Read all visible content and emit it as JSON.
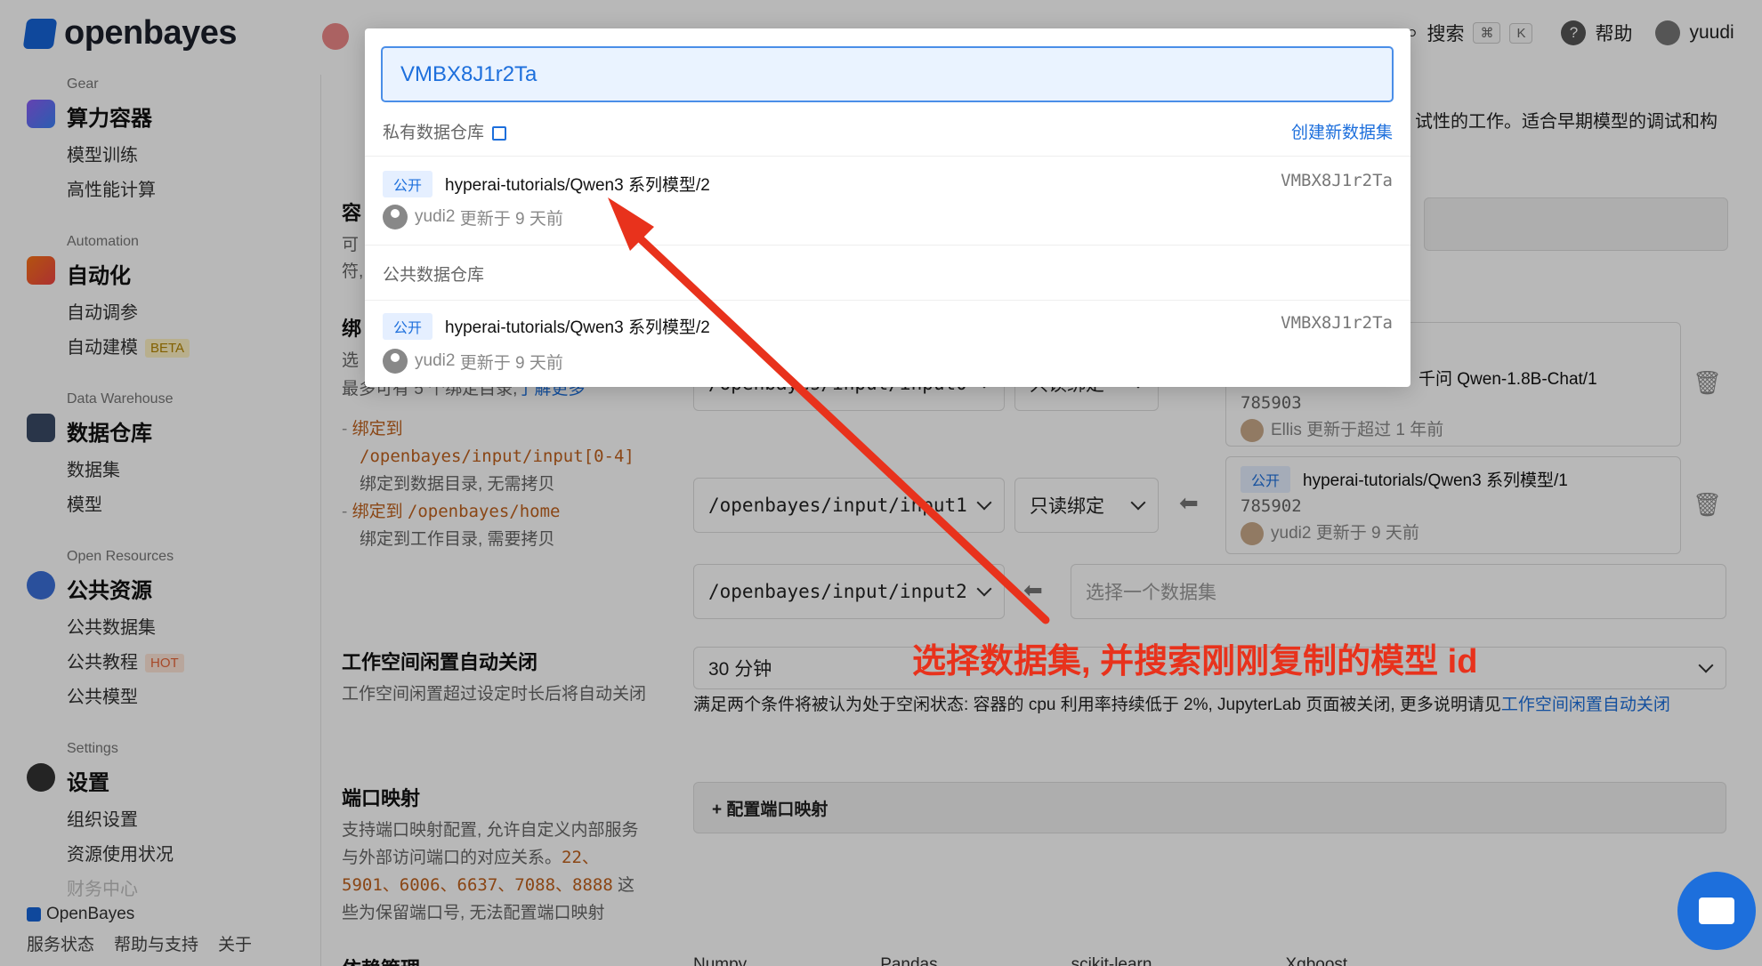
{
  "brand": {
    "name": "openbayes",
    "footer_name": "OpenBayes"
  },
  "sidebar": {
    "sections": [
      {
        "en": "Gear",
        "title": "算力容器",
        "items": [
          "模型训练",
          "高性能计算"
        ]
      },
      {
        "en": "Automation",
        "title": "自动化",
        "items": [
          "自动调参",
          "自动建模"
        ],
        "badge": "BETA"
      },
      {
        "en": "Data Warehouse",
        "title": "数据仓库",
        "items": [
          "数据集",
          "模型"
        ]
      },
      {
        "en": "Open Resources",
        "title": "公共资源",
        "items": [
          "公共数据集",
          "公共教程",
          "公共模型"
        ],
        "badge": "HOT"
      },
      {
        "en": "Settings",
        "title": "设置",
        "items": [
          "组织设置",
          "资源使用状况",
          "财务中心"
        ]
      }
    ],
    "footer_links": [
      "服务状态",
      "帮助与支持",
      "关于"
    ]
  },
  "header": {
    "search_label": "搜索",
    "kbd1": "⌘",
    "kbd2": "K",
    "help_label": "帮助",
    "user": "yuudi"
  },
  "modal": {
    "search_value": "VMBX8J1r2Ta",
    "private_label": "私有数据仓库",
    "create_label": "创建新数据集",
    "public_label": "公共数据仓库",
    "results": [
      {
        "tag": "公开",
        "name": "hyperai-tutorials/Qwen3 系列模型/2",
        "id": "VMBX8J1r2Ta",
        "user": "yudi2",
        "updated": "更新于 9 天前"
      },
      {
        "tag": "公开",
        "name": "hyperai-tutorials/Qwen3 系列模型/2",
        "id": "VMBX8J1r2Ta",
        "user": "yudi2",
        "updated": "更新于 9 天前"
      }
    ]
  },
  "main": {
    "intro_tail": "试性的工作。适合早期模型的调试和构",
    "container_title": "容",
    "container_desc1": "可",
    "container_desc2": "符,",
    "bind_title": "绑",
    "bind_desc1": "选",
    "bind_desc2": "最多可有 5 个绑定目录,",
    "bind_learn_more": "了解更多",
    "bind_rule1_prefix": "绑定到",
    "bind_rule1_path": "/openbayes/input/input[0-4]",
    "bind_rule1_desc": "绑定到数据目录, 无需拷贝",
    "bind_rule2_prefix": "绑定到",
    "bind_rule2_path": "/openbayes/home",
    "bind_rule2_desc": "绑定到工作目录, 需要拷贝",
    "bindings": [
      {
        "path": "/openbayes/input/input0",
        "mode": "只读绑定",
        "ds_name": "千问 Qwen-1.8B-Chat/1",
        "ds_id": "785903",
        "ds_user": "Ellis",
        "ds_updated": "更新于超过 1 年前"
      },
      {
        "path": "/openbayes/input/input1",
        "mode": "只读绑定",
        "ds_tag": "公开",
        "ds_name": "hyperai-tutorials/Qwen3 系列模型/1",
        "ds_id": "785902",
        "ds_user": "yudi2",
        "ds_updated": "更新于 9 天前"
      },
      {
        "path": "/openbayes/input/input2",
        "placeholder": "选择一个数据集"
      }
    ],
    "idle_title": "工作空间闲置自动关闭",
    "idle_desc": "工作空间闲置超过设定时长后将自动关闭",
    "idle_value": "30 分钟",
    "idle_note": "满足两个条件将被认为处于空闲状态: 容器的 cpu 利用率持续低于 2%, JupyterLab 页面被关闭, 更多说明请见",
    "idle_link": "工作空间闲置自动关闭",
    "port_title": "端口映射",
    "port_desc1": "支持端口映射配置, 允许自定义内部服务",
    "port_desc2": "与外部访问端口的对应关系。",
    "port_reserved1": "22、",
    "port_reserved2": "5901、6006、6637、7088、8888",
    "port_desc3": " 这",
    "port_desc4": "些为保留端口号, 无法配置端口映射",
    "port_button": "+ 配置端口映射",
    "deps_title": "依赖管理",
    "deps": [
      "Numpy",
      "Pandas",
      "scikit-learn",
      "Xgboost"
    ]
  },
  "annotation": "选择数据集, 并搜索刚刚复制的模型 id"
}
